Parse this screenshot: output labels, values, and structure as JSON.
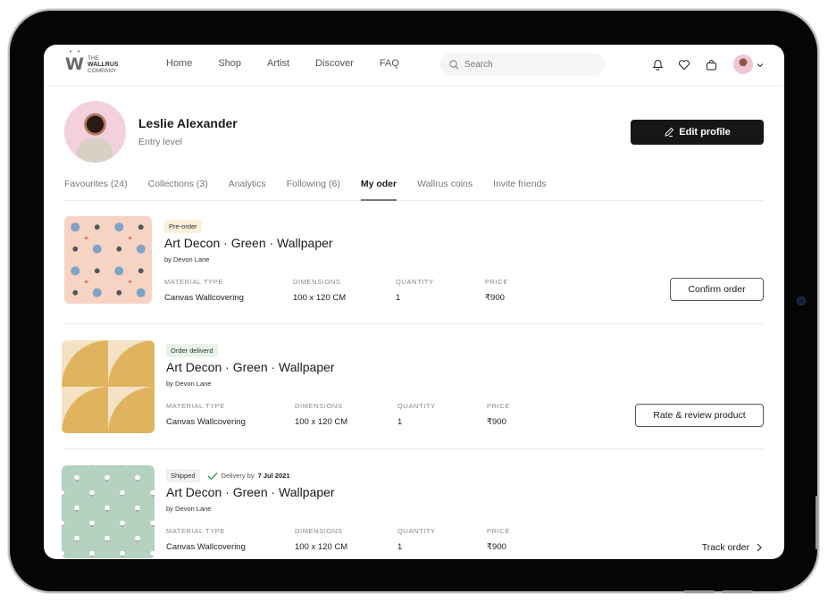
{
  "header": {
    "logo": {
      "mark": "W",
      "line1": "THE",
      "line2": "WALLRUS",
      "line3": "COMPANY"
    },
    "nav": [
      "Home",
      "Shop",
      "Artist",
      "Discover",
      "FAQ"
    ],
    "search": {
      "placeholder": "Search",
      "value": ""
    },
    "icons": [
      "bell-icon",
      "heart-icon",
      "shopping-bag-icon",
      "avatar",
      "chevron-down-icon"
    ]
  },
  "profile": {
    "name": "Leslie Alexander",
    "level": "Entry level",
    "edit_label": "Edit profile"
  },
  "tabs": [
    {
      "label": "Favourites (24)",
      "active": false
    },
    {
      "label": "Collections (3)",
      "active": false
    },
    {
      "label": "Analytics",
      "active": false
    },
    {
      "label": "Following (6)",
      "active": false
    },
    {
      "label": "My oder",
      "active": true
    },
    {
      "label": "Wallrus coins",
      "active": false
    },
    {
      "label": "Invite friends",
      "active": false
    }
  ],
  "labels": {
    "material": "MATERIAL TYPE",
    "dimensions": "DIMENSIONS",
    "quantity": "QUANTITY",
    "price": "PRICE"
  },
  "orders": [
    {
      "status": "Pre-order",
      "status_color": "#fdf0d9",
      "title": "Art Decon · Green · Wallpaper",
      "by": "by Devon Lane",
      "material": "Canvas Wallcovering",
      "dimensions": "100 x 120 CM",
      "quantity": "1",
      "price": "₹900",
      "action": "Confirm order"
    },
    {
      "status": "Order deliverd",
      "status_color": "#e6f4ea",
      "title": "Art Decon · Green · Wallpaper",
      "by": "by Devon Lane",
      "material": "Canvas Wallcovering",
      "dimensions": "100 x 120 CM",
      "quantity": "1",
      "price": "₹900",
      "action": "Rate & review product"
    },
    {
      "status": "Shipped",
      "status_color": "#f0f0f0",
      "delivery_prefix": "Delivery by",
      "delivery_date": "7 Jul 2021",
      "title": "Art Decon · Green · Wallpaper",
      "by": "by Devon Lane",
      "material": "Canvas Wallcovering",
      "dimensions": "100 x 120 CM",
      "quantity": "1",
      "price": "₹900",
      "action": "Track order"
    }
  ],
  "colors": {
    "accent_dark": "#161616",
    "check_green": "#2e9e5b"
  }
}
